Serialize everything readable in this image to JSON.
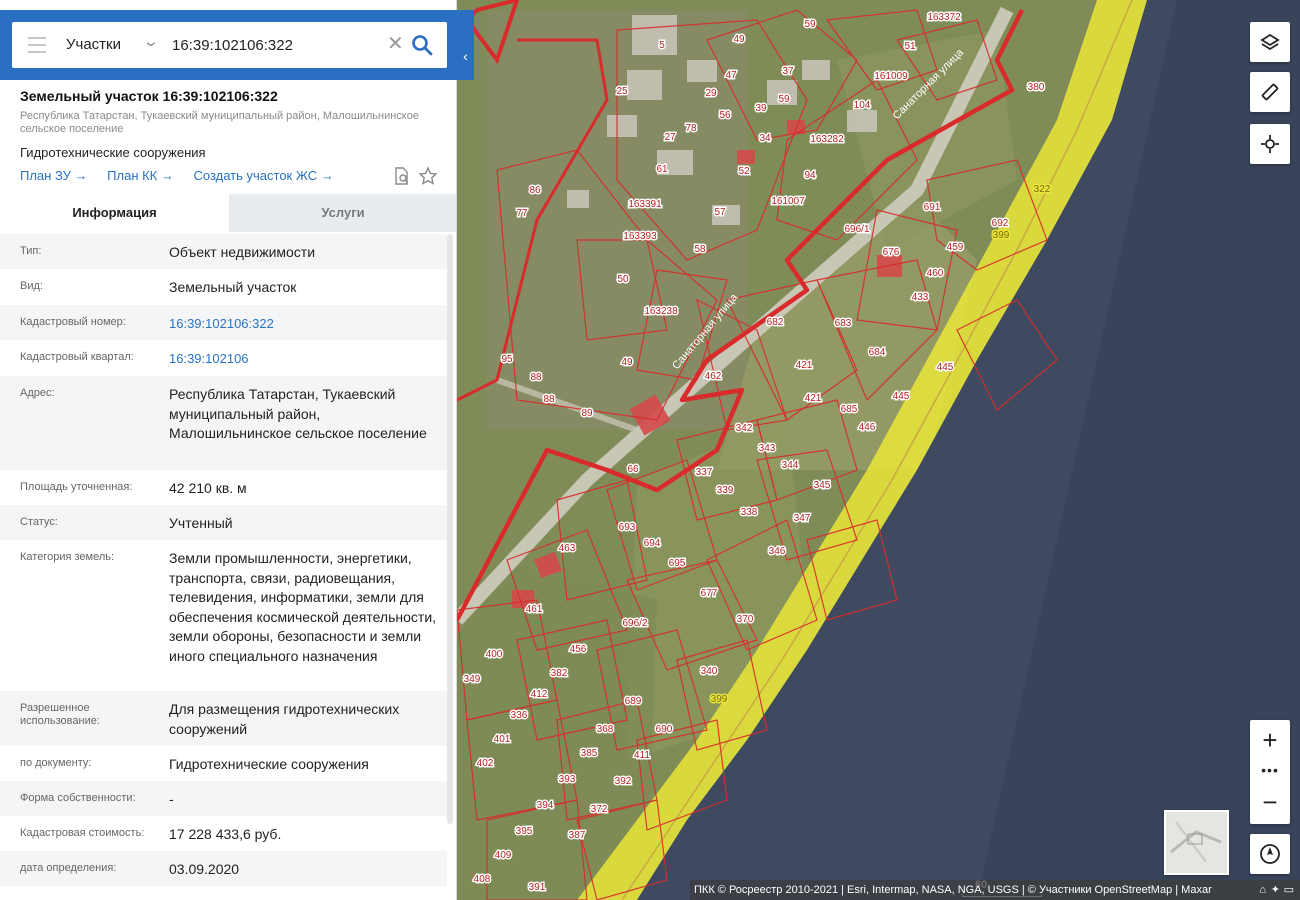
{
  "search": {
    "type_label": "Участки",
    "value": "16:39:102106:322"
  },
  "object": {
    "title": "Земельный участок 16:39:102106:322",
    "address_short": "Республика Татарстан, Тукаевский муниципальный район, Малошильнинское сельское поселение",
    "use": "Гидротехнические сооружения",
    "links": [
      "План ЗУ →",
      "План КК →",
      "Создать участок ЖС →"
    ]
  },
  "tabs": {
    "info": "Информация",
    "services": "Услуги"
  },
  "info_rows": [
    {
      "label": "Тип:",
      "value": "Объект недвижимости"
    },
    {
      "label": "Вид:",
      "value": "Земельный участок"
    },
    {
      "label": "Кадастровый номер:",
      "value": "16:39:102106:322"
    },
    {
      "label": "Кадастровый квартал:",
      "value": "16:39:102106"
    },
    {
      "label": "Адрес:",
      "value": "Республика Татарстан, Тукаевский муниципальный район, Малошильнинское сельское поселение"
    },
    {
      "label": "Площадь уточненная:",
      "value": "42 210 кв. м"
    },
    {
      "label": "Статус:",
      "value": "Учтенный"
    },
    {
      "label": "Категория земель:",
      "value": "Земли промышленности, энергетики, транспорта, связи, радиовещания, телевидения, информатики, земли для обеспечения космической деятельности, земли обороны, безопасности и земли иного специального назначения"
    },
    {
      "label": "Разрешенное использование:",
      "value": "Для размещения гидротехнических сооружений"
    },
    {
      "label": "по документу:",
      "value": "Гидротехнические сооружения"
    },
    {
      "label": "Форма собственности:",
      "value": "-"
    },
    {
      "label": "Кадастровая стоимость:",
      "value": "17 228 433,6 руб."
    },
    {
      "label": "дата определения:",
      "value": "03.09.2020"
    }
  ],
  "map": {
    "street_label": "Санаторная улица",
    "scale_label": "60",
    "attribution": "ПКК © Росреестр 2010-2021 | Esri, Intermap, NASA, NGA, USGS | © Участники OpenStreetMap | Maxar",
    "parcels": [
      {
        "label": "5"
      },
      {
        "label": "49"
      },
      {
        "label": "59"
      },
      {
        "label": "163372"
      },
      {
        "label": "51"
      },
      {
        "label": "25"
      },
      {
        "label": "47"
      },
      {
        "label": "37"
      },
      {
        "label": "29"
      },
      {
        "label": "59"
      },
      {
        "label": "161009"
      },
      {
        "label": "104"
      },
      {
        "label": "39"
      },
      {
        "label": "56"
      },
      {
        "label": "78"
      },
      {
        "label": "34"
      },
      {
        "label": "27"
      },
      {
        "label": "163282"
      },
      {
        "label": "61"
      },
      {
        "label": "52"
      },
      {
        "label": "94"
      },
      {
        "label": "86"
      },
      {
        "label": "163391"
      },
      {
        "label": "161007"
      },
      {
        "label": "77"
      },
      {
        "label": "57"
      },
      {
        "label": "163393"
      },
      {
        "label": "58"
      },
      {
        "label": "50"
      },
      {
        "label": "163238"
      },
      {
        "label": "49"
      },
      {
        "label": "95"
      },
      {
        "label": "88"
      },
      {
        "label": "88"
      },
      {
        "label": "89"
      },
      {
        "label": "380"
      },
      {
        "label": "322"
      },
      {
        "label": "691"
      },
      {
        "label": "692"
      },
      {
        "label": "696/1"
      },
      {
        "label": "676"
      },
      {
        "label": "459"
      },
      {
        "label": "399"
      },
      {
        "label": "460"
      },
      {
        "label": "433"
      },
      {
        "label": "682"
      },
      {
        "label": "683"
      },
      {
        "label": "421"
      },
      {
        "label": "684"
      },
      {
        "label": "445"
      },
      {
        "label": "462"
      },
      {
        "label": "421"
      },
      {
        "label": "445"
      },
      {
        "label": "685"
      },
      {
        "label": "446"
      },
      {
        "label": "342"
      },
      {
        "label": "343"
      },
      {
        "label": "66"
      },
      {
        "label": "337"
      },
      {
        "label": "344"
      },
      {
        "label": "339"
      },
      {
        "label": "345"
      },
      {
        "label": "338"
      },
      {
        "label": "347"
      },
      {
        "label": "693"
      },
      {
        "label": "463"
      },
      {
        "label": "694"
      },
      {
        "label": "695"
      },
      {
        "label": "346"
      },
      {
        "label": "677"
      },
      {
        "label": "461"
      },
      {
        "label": "696/2"
      },
      {
        "label": "370"
      },
      {
        "label": "400"
      },
      {
        "label": "456"
      },
      {
        "label": "349"
      },
      {
        "label": "382"
      },
      {
        "label": "340"
      },
      {
        "label": "412"
      },
      {
        "label": "399"
      },
      {
        "label": "689"
      },
      {
        "label": "336"
      },
      {
        "label": "368"
      },
      {
        "label": "690"
      },
      {
        "label": "401"
      },
      {
        "label": "385"
      },
      {
        "label": "411"
      },
      {
        "label": "402"
      },
      {
        "label": "393"
      },
      {
        "label": "392"
      },
      {
        "label": "394"
      },
      {
        "label": "372"
      },
      {
        "label": "395"
      },
      {
        "label": "387"
      },
      {
        "label": "409"
      },
      {
        "label": "408"
      },
      {
        "label": "391"
      }
    ]
  },
  "colors": {
    "header": "#2b6fc2",
    "link": "#2a72c3",
    "parcel_line": "#d92b2b",
    "water": "#3f4a60",
    "zone": "#e9e63a"
  }
}
